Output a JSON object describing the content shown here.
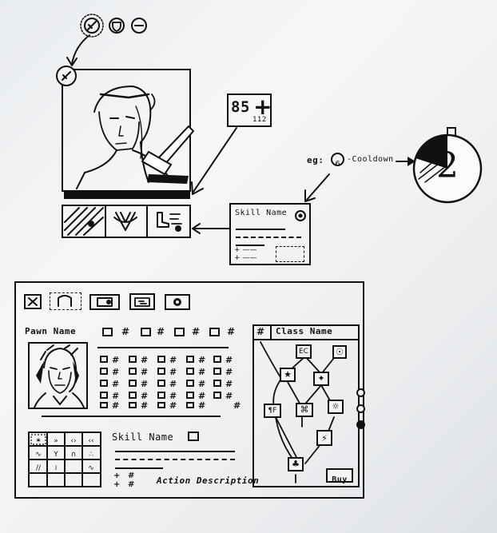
{
  "top_icons": {
    "sword": "sword-icon",
    "shield": "shield-icon",
    "minus": "minus-icon"
  },
  "health": {
    "current": "85",
    "max": "112",
    "plus_symbol": "+"
  },
  "skill_card": {
    "title": "Skill Name"
  },
  "cooldown_example": {
    "label_prefix": "eg:",
    "number": "6",
    "label_suffix": "-Cooldown",
    "big_number": "2"
  },
  "panel": {
    "pawn_name": "Pawn Name",
    "class_name": "Class Name",
    "skill_name": "Skill Name",
    "action_description": "Action Description",
    "buy_label": "Buy",
    "hash": "#",
    "plus": "+"
  },
  "skill_tree_nodes": [
    "EC",
    "☉",
    "★",
    "✦",
    "¶F",
    "⌘",
    "☼",
    "⚡",
    "♣"
  ],
  "skill_grid_glyphs": [
    "✶",
    "»",
    "‹›",
    "‹‹",
    "∿",
    "Y",
    "∩",
    "∴",
    "//",
    "≀",
    "",
    "∿",
    "",
    "",
    "",
    ""
  ]
}
